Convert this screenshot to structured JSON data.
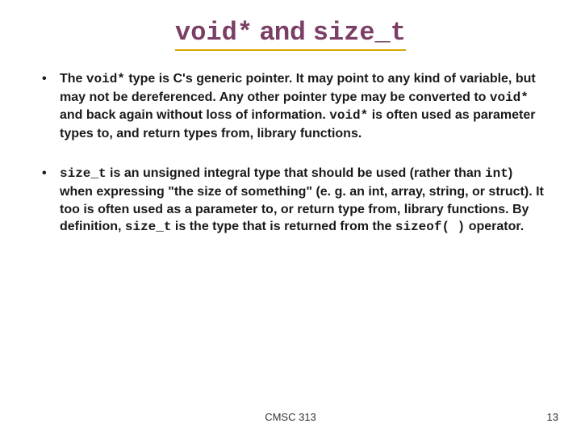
{
  "title": {
    "code1": "void*",
    "mid": " and ",
    "code2": "size_t"
  },
  "bullets": {
    "b1": {
      "t1": "The ",
      "c1": "void*",
      "t2": " type is C's generic pointer.  It may point to any kind of variable, but may not be dereferenced. Any other pointer type may be converted to ",
      "c2": "void*",
      "t3": " and back again without loss of information.  ",
      "c3": "void*",
      "t4": " is often used as parameter types to, and return types from, library functions."
    },
    "b2": {
      "c1": "size_t",
      "t1": " is an unsigned integral type that should be used (rather than ",
      "c2": "int",
      "t2": ") when expressing \"the size of something\" (e. g. an int, array, string, or struct).  It too is often used as a parameter to, or return type from, library functions.  By definition, ",
      "c3": "size_t",
      "t3": " is the type that is returned from the ",
      "c4": "sizeof( )",
      "t4": " operator."
    }
  },
  "footer": {
    "course": "CMSC 313",
    "page": "13"
  }
}
